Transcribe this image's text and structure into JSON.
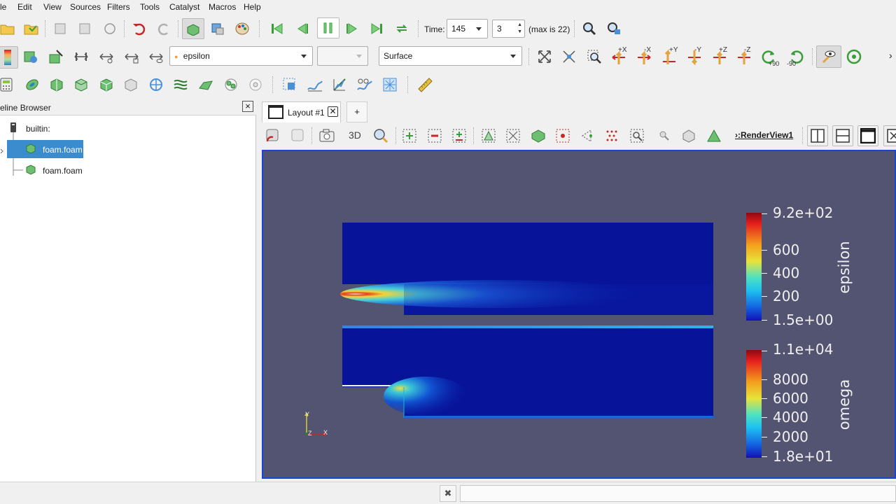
{
  "menu": [
    "le",
    "Edit",
    "View",
    "Sources",
    "Filters",
    "Tools",
    "Catalyst",
    "Macros",
    "Help"
  ],
  "time_label": "Time:",
  "time_value": "145",
  "timestep_value": "3",
  "timestep_max": "(max is 22)",
  "array_combo": "epsilon",
  "representation_combo": "Surface",
  "camera_labels": {
    "plus_x": "+X",
    "minus_x": "-X",
    "plus_y": "+Y",
    "minus_y": "-Y",
    "plus_z": "+Z",
    "minus_z": "-Z",
    "rot_plus": "+90",
    "rot_minus": "-90"
  },
  "pipeline": {
    "title": "eline Browser",
    "items": [
      "builtin:",
      "foam.foam",
      "foam.foam"
    ]
  },
  "layout_tab": "Layout #1",
  "add_tab": "+",
  "render_toolbar": {
    "mode_3d": "3D",
    "view_name": "RenderView1"
  },
  "colorbars": [
    {
      "title": "epsilon",
      "labels": [
        "9.2e+02",
        "600",
        "400",
        "200",
        "1.5e+00"
      ]
    },
    {
      "title": "omega",
      "labels": [
        "1.1e+04",
        "8000",
        "6000",
        "4000",
        "2000",
        "1.8e+01"
      ]
    }
  ],
  "axes": {
    "x": "X",
    "y": "Y",
    "z": "Z"
  },
  "colors": {
    "selection": "#3a8ccf",
    "viewport_bg": "#535471",
    "active_view_border": "#1646d6"
  }
}
